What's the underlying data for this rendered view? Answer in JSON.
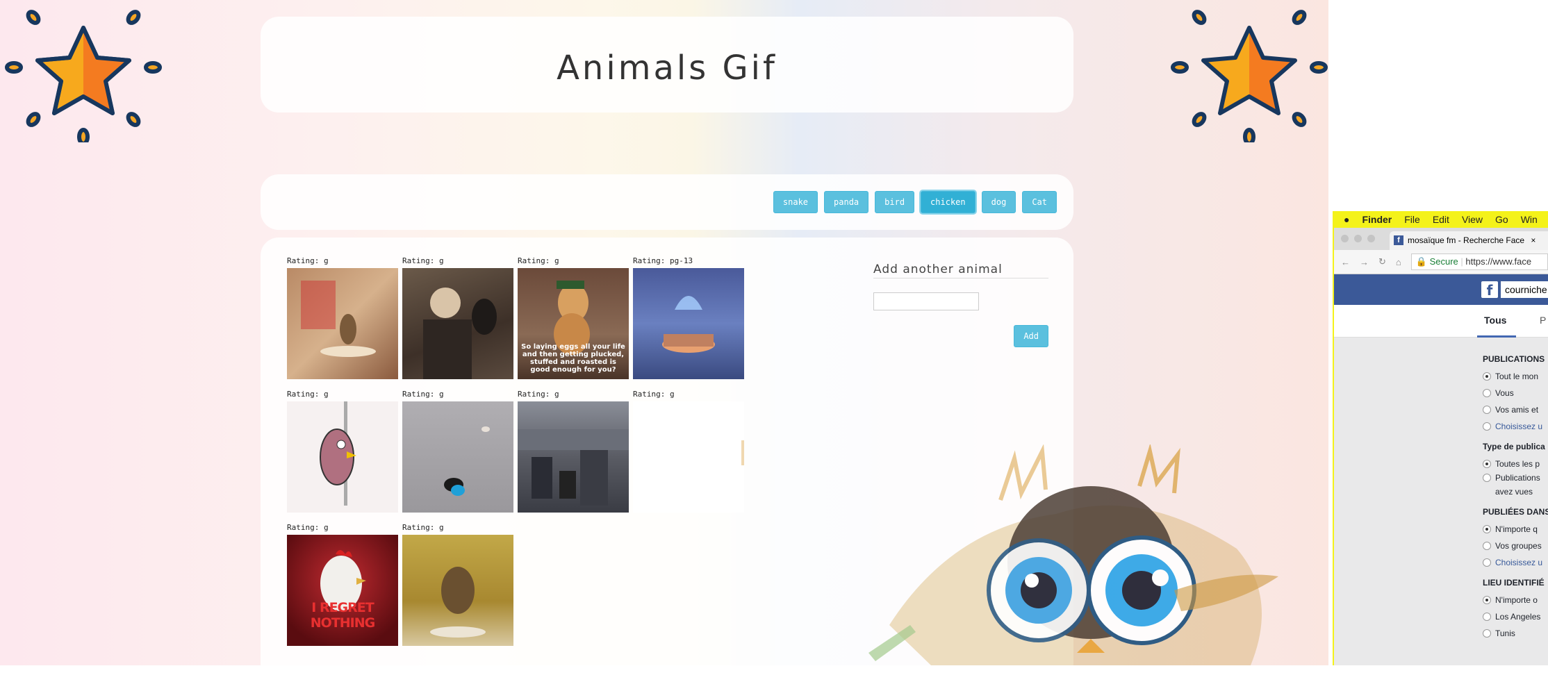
{
  "page": {
    "title": "Animals Gif"
  },
  "topics": [
    "snake",
    "panda",
    "bird",
    "chicken",
    "dog",
    "Cat"
  ],
  "active_topic": "chicken",
  "gifs": [
    {
      "rating": "Rating: g",
      "bg": "#b98a66",
      "caption": ""
    },
    {
      "rating": "Rating: g",
      "bg": "#5a4a3e",
      "caption": ""
    },
    {
      "rating": "Rating: g",
      "bg": "#7a5a48",
      "caption": "So laying eggs all your life and then getting plucked, stuffed and roasted is good enough for you?"
    },
    {
      "rating": "Rating: pg-13",
      "bg": "#5a6fa8",
      "caption": ""
    },
    {
      "rating": "Rating: g",
      "bg": "#f2ecec",
      "caption": ""
    },
    {
      "rating": "Rating: g",
      "bg": "#a8a5a8",
      "caption": ""
    },
    {
      "rating": "Rating: g",
      "bg": "#5e6068",
      "caption": ""
    },
    {
      "rating": "Rating: g",
      "bg": "#ffffff",
      "caption": ""
    },
    {
      "rating": "Rating: g",
      "bg": "#8a1a1e",
      "caption": "",
      "big": "I REGRET NOTHING"
    },
    {
      "rating": "Rating: g",
      "bg": "#b89a3c",
      "caption": ""
    }
  ],
  "form": {
    "heading": "Add another animal",
    "input_value": "",
    "button": "Add"
  },
  "mac": {
    "menu": [
      "Finder",
      "File",
      "Edit",
      "View",
      "Go",
      "Win"
    ],
    "tab_title": "mosaïque fm - Recherche Face",
    "url_secure": "Secure",
    "url": "https://www.face",
    "fb_search": "courniche",
    "fb_tab1": "Tous",
    "fb_tab2": "P",
    "sections": [
      {
        "heading": "PUBLICATIONS",
        "options": [
          {
            "label": "Tout le mon",
            "on": true
          },
          {
            "label": "Vous",
            "on": false
          },
          {
            "label": "Vos amis et",
            "on": false
          }
        ],
        "link": "Choisissez u"
      },
      {
        "heading": "Type de publica",
        "options": [
          {
            "label": "Toutes les p",
            "on": true
          },
          {
            "label": "Publications",
            "on": false
          }
        ],
        "extra": "avez vues"
      },
      {
        "heading": "PUBLIÉES DANS",
        "options": [
          {
            "label": "N'importe q",
            "on": true
          },
          {
            "label": "Vos groupes",
            "on": false
          }
        ],
        "link": "Choisissez u"
      },
      {
        "heading": "LIEU IDENTIFIÉ",
        "options": [
          {
            "label": "N'importe o",
            "on": true
          },
          {
            "label": "Los Angeles",
            "on": false
          },
          {
            "label": "Tunis",
            "on": false
          }
        ]
      }
    ]
  }
}
